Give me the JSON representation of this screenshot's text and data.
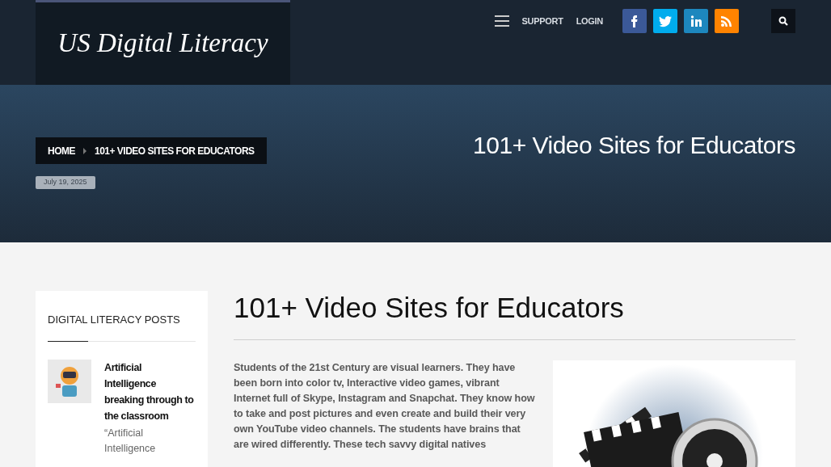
{
  "header": {
    "logo": "US Digital Literacy",
    "nav": [
      "SUPPORT",
      "LOGIN"
    ],
    "social": [
      {
        "kind": "facebook",
        "color": "#3b5998"
      },
      {
        "kind": "twitter",
        "color": "#00aced"
      },
      {
        "kind": "linkedin",
        "color": "#1d87be"
      },
      {
        "kind": "rss",
        "color": "#ff8300"
      }
    ]
  },
  "hero": {
    "breadcrumb": [
      "HOME",
      "101+ VIDEO SITES FOR EDUCATORS"
    ],
    "date": "July 19, 2025",
    "title": "101+ Video Sites for Educators"
  },
  "sidebar": {
    "heading": "DIGITAL LITERACY POSTS",
    "posts": [
      {
        "title": "Artificial Intelligence breaking through to the classroom",
        "excerpt": "“Artificial Intelligence"
      }
    ]
  },
  "article": {
    "title": "101+ Video Sites for Educators",
    "body": "Students of the 21st Century are visual learners. They have been born into color tv,  Interactive video games, vibrant Internet full of Skype, Instagram and Snapchat. They know how to take and post pictures and even create and build their very own YouTube video channels. The students have brains that are wired differently. These tech savvy digital natives"
  }
}
